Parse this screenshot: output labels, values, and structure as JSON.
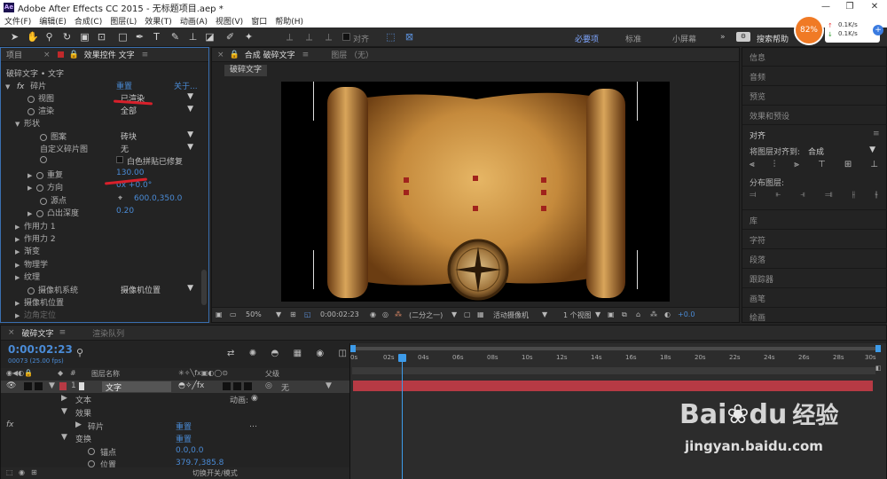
{
  "window": {
    "title": "Adobe After Effects CC 2015 - 无标题项目.aep *",
    "app_icon": "Ae"
  },
  "menu": [
    "文件(F)",
    "编辑(E)",
    "合成(C)",
    "图层(L)",
    "效果(T)",
    "动画(A)",
    "视图(V)",
    "窗口",
    "帮助(H)"
  ],
  "toolbar": {
    "snap_label": "对齐",
    "workspaces": [
      "必要项",
      "标准",
      "小屏幕"
    ],
    "search_placeholder": "搜索帮助"
  },
  "net_widget": {
    "percent": "82%",
    "up": "0.1K/s",
    "down": "0.1K/s"
  },
  "left_panel": {
    "tabs": [
      "项目",
      "效果控件 文字"
    ],
    "breadcrumb": "破碎文字 • 文字",
    "effect": {
      "name": "碎片",
      "reset": "重置",
      "about": "关于..."
    },
    "rows": [
      {
        "label": "视图",
        "value": "已渲染"
      },
      {
        "label": "渲染",
        "value": "全部"
      },
      {
        "label": "形状",
        "value": ""
      },
      {
        "label": "图案",
        "value": "砖块"
      },
      {
        "label": "自定义碎片图",
        "value": "无"
      },
      {
        "label": "",
        "value": "白色拼贴已修复"
      },
      {
        "label": "重复",
        "value": "130.00"
      },
      {
        "label": "方向",
        "value": "0x +0.0°"
      },
      {
        "label": "源点",
        "value": "600.0,350.0"
      },
      {
        "label": "凸出深度",
        "value": "0.20"
      },
      {
        "label": "作用力 1",
        "value": ""
      },
      {
        "label": "作用力 2",
        "value": ""
      },
      {
        "label": "渐变",
        "value": ""
      },
      {
        "label": "物理学",
        "value": ""
      },
      {
        "label": "纹理",
        "value": ""
      },
      {
        "label": "摄像机系统",
        "value": "摄像机位置"
      },
      {
        "label": "摄像机位置",
        "value": ""
      },
      {
        "label": "边角定位",
        "value": ""
      }
    ]
  },
  "comp_panel": {
    "tabs": [
      "合成 破碎文字",
      "图层 （无）"
    ],
    "subtab": "破碎文字",
    "footer": {
      "zoom": "50%",
      "timecode": "0:00:02:23",
      "resolution": "(二分之一)",
      "camera": "活动摄像机",
      "views": "1 个视图",
      "exposure": "+0.0"
    }
  },
  "right_panel": {
    "items_top": [
      "信息",
      "音频",
      "预览",
      "效果和预设"
    ],
    "align": {
      "title": "对齐",
      "align_to_label": "将图层对齐到:",
      "align_to_value": "合成",
      "distribute_label": "分布图层:"
    },
    "items_bottom": [
      "库",
      "字符",
      "段落",
      "跟踪器",
      "画笔",
      "绘画"
    ]
  },
  "timeline": {
    "tabs": [
      "破碎文字",
      "渲染队列"
    ],
    "timecode": "0:00:02:23",
    "frame_info": "00073 (25.00 fps)",
    "col_headers": {
      "num": "#",
      "name": "图层名称",
      "parent": "父级"
    },
    "layer": {
      "num": "1",
      "name": "文字",
      "parent": "无"
    },
    "sub_rows": [
      {
        "label": "文本",
        "extra": "动画: ",
        "value": ""
      },
      {
        "label": "效果",
        "extra": "",
        "value": ""
      },
      {
        "label": "碎片",
        "extra": "",
        "value": "重置"
      },
      {
        "label": "变换",
        "extra": "",
        "value": "重置"
      },
      {
        "label": "锚点",
        "extra": "",
        "value": "0.0,0.0"
      },
      {
        "label": "位置",
        "extra": "",
        "value": "379.7,385.8"
      }
    ],
    "ruler": [
      "0s",
      "02s",
      "04s",
      "06s",
      "08s",
      "10s",
      "12s",
      "14s",
      "16s",
      "18s",
      "20s",
      "22s",
      "24s",
      "26s",
      "28s",
      "30s"
    ],
    "footer": "切换开关/模式"
  },
  "watermark": {
    "brand": "Bai",
    "brand2": "du",
    "cn": "经验",
    "url": "jingyan.baidu.com"
  },
  "colors": {
    "accent_blue": "#4a8bd6",
    "layer_bar": "#b63a44",
    "annotation_red": "#d8202b",
    "playhead": "#3d9be9"
  }
}
